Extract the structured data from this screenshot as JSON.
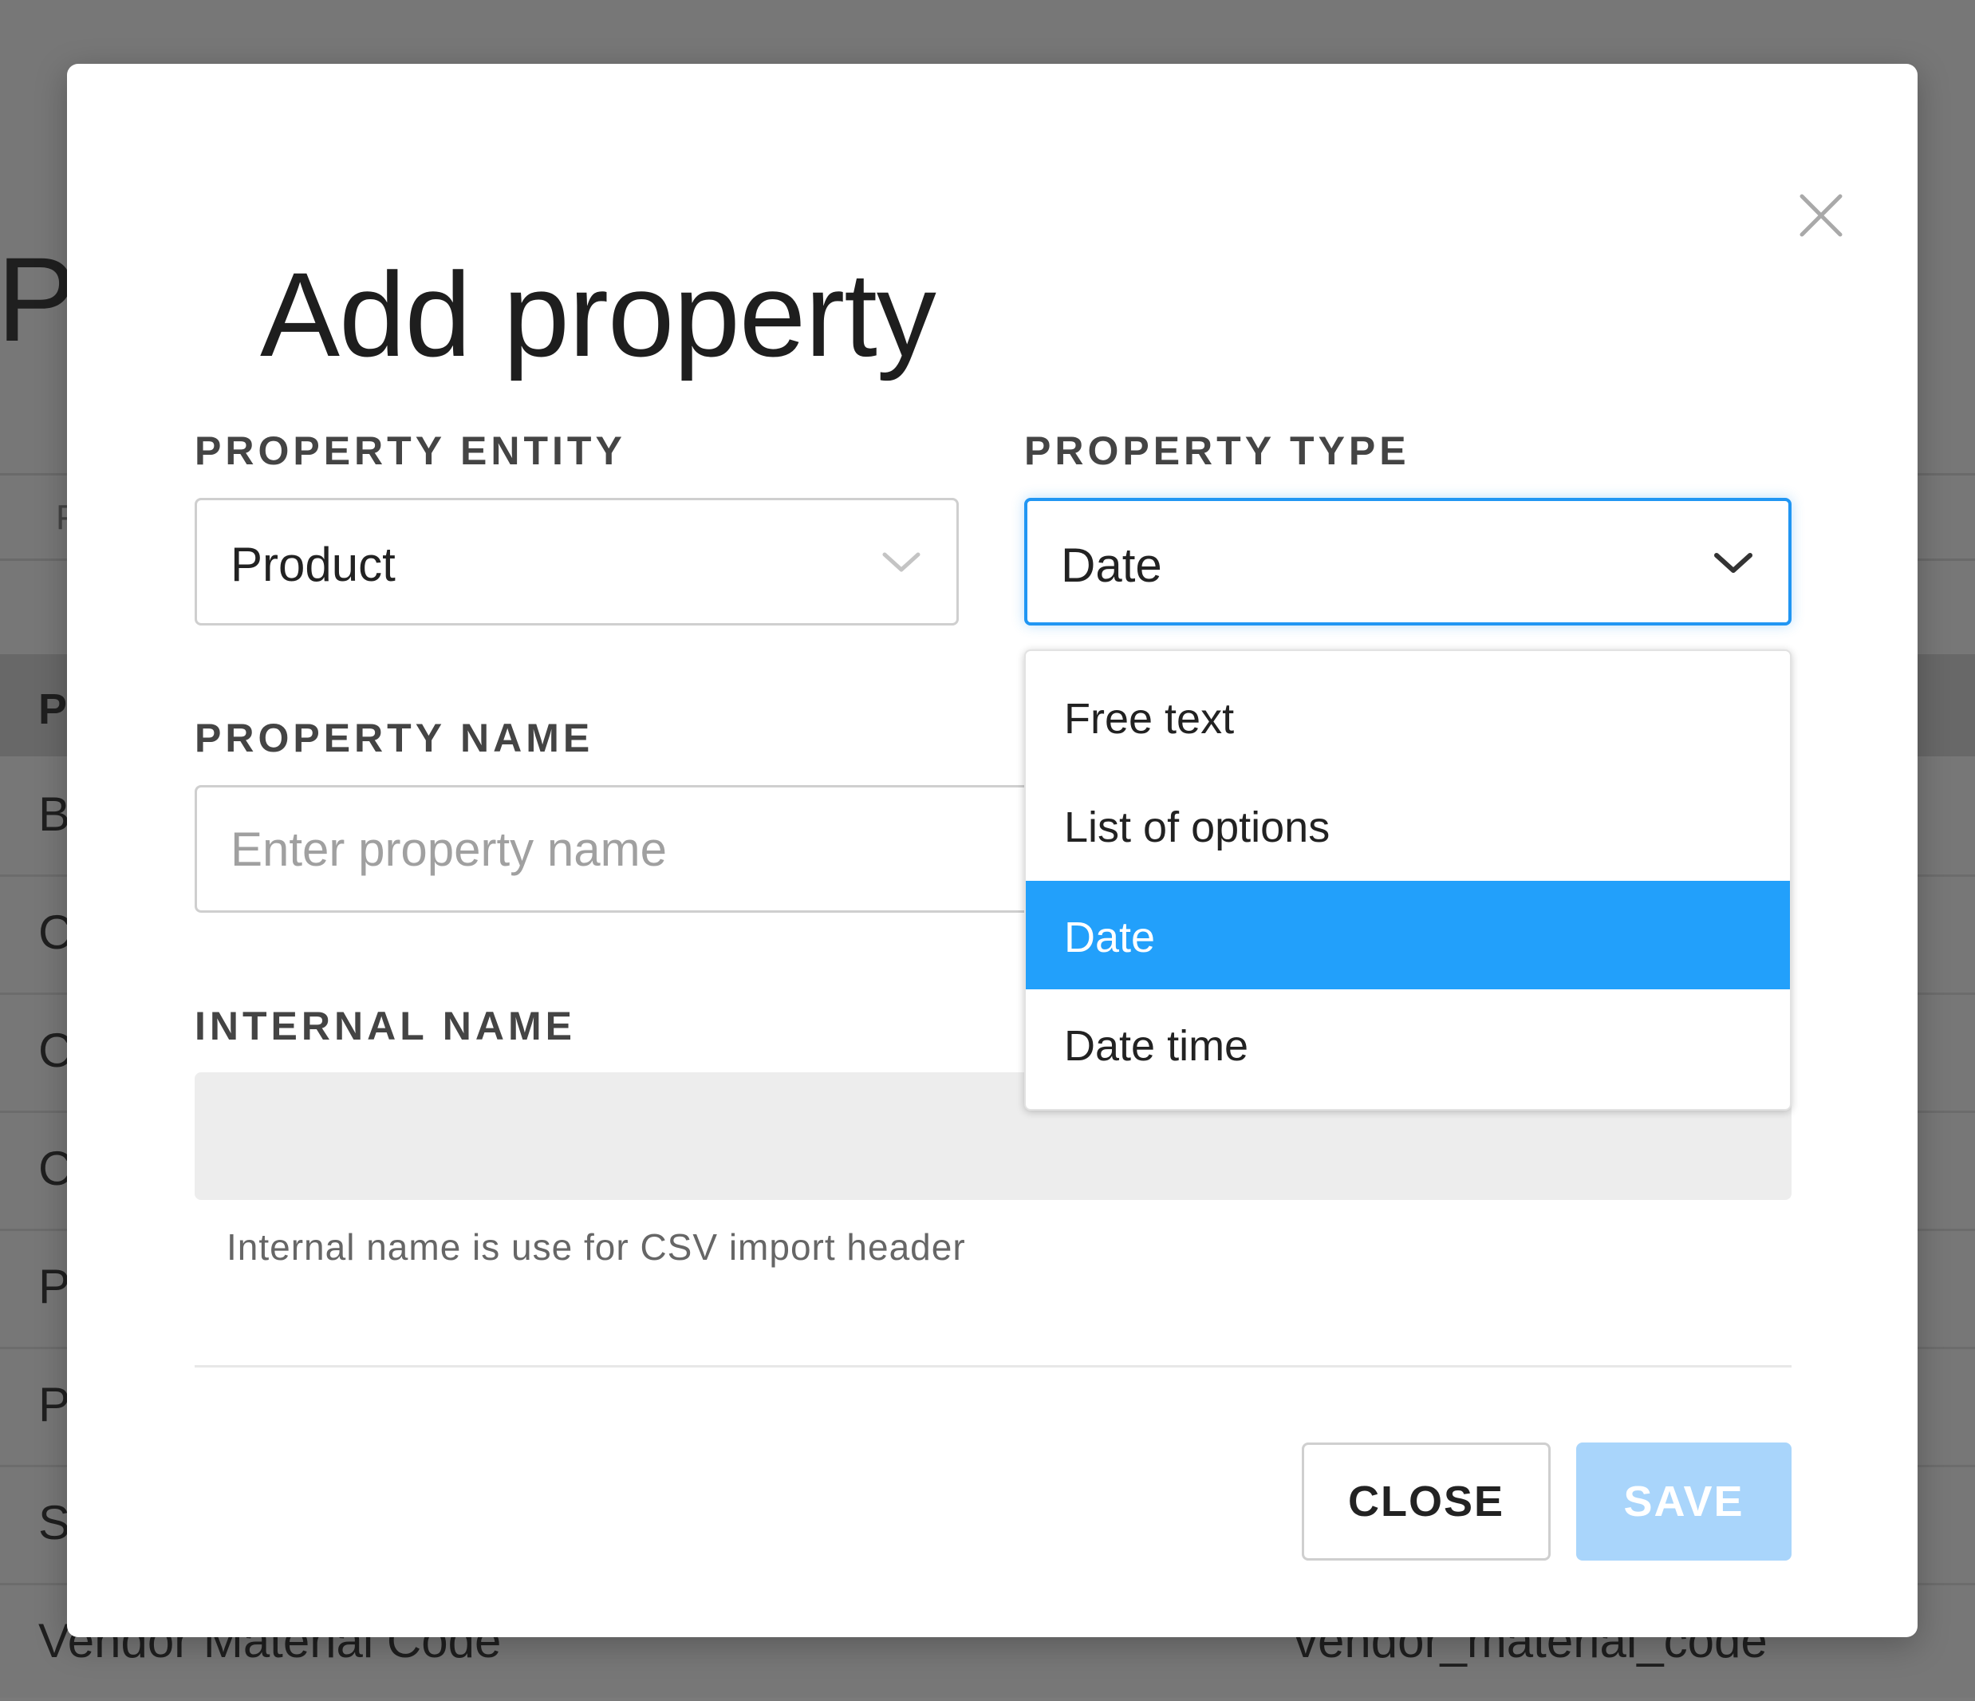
{
  "background": {
    "title_fragment": "P",
    "tab_fragment": "P",
    "header_fragment": "P",
    "rows": [
      {
        "c1": "B",
        "c2": ""
      },
      {
        "c1": "C",
        "c2": ""
      },
      {
        "c1": "C",
        "c2": ""
      },
      {
        "c1": "C",
        "c2": ""
      },
      {
        "c1": "P",
        "c2": ""
      },
      {
        "c1": "P",
        "c2": ""
      },
      {
        "c1": "S",
        "c2": ""
      },
      {
        "c1": "Vendor Material Code",
        "c2": "vendor_material_code"
      }
    ]
  },
  "modal": {
    "title": "Add property",
    "close_icon": "close-icon",
    "property_entity": {
      "label": "PROPERTY ENTITY",
      "value": "Product"
    },
    "property_type": {
      "label": "PROPERTY TYPE",
      "value": "Date",
      "options": [
        {
          "label": "Free text",
          "selected": false
        },
        {
          "label": "List of options",
          "selected": false
        },
        {
          "label": "Date",
          "selected": true
        },
        {
          "label": "Date time",
          "selected": false
        }
      ]
    },
    "property_name": {
      "label": "PROPERTY NAME",
      "placeholder": "Enter property name",
      "value": ""
    },
    "internal_name": {
      "label": "INTERNAL NAME",
      "value": "",
      "help": "Internal name is use for CSV import header"
    },
    "buttons": {
      "close": "CLOSE",
      "save": "SAVE"
    }
  },
  "colors": {
    "accent": "#2196f3",
    "selected_option": "#22a0fb",
    "save_disabled": "#a9d5fb",
    "overlay": "#777777"
  }
}
